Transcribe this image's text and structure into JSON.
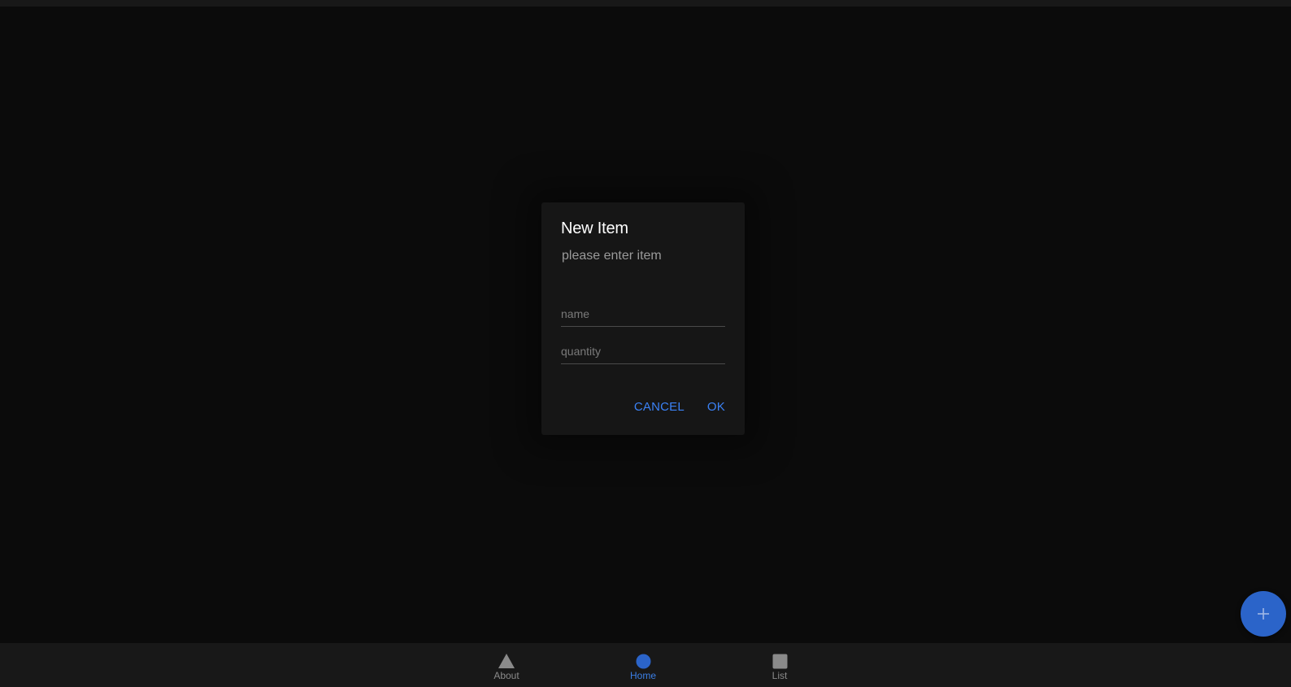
{
  "dialog": {
    "title": "New Item",
    "message": "please enter item",
    "name_placeholder": "name",
    "name_value": "",
    "quantity_placeholder": "quantity",
    "quantity_value": "",
    "cancel_label": "CANCEL",
    "ok_label": "OK"
  },
  "fab": {
    "icon": "plus-icon"
  },
  "bottom_nav": {
    "items": [
      {
        "label": "About",
        "icon": "triangle-icon",
        "active": false
      },
      {
        "label": "Home",
        "icon": "circle-icon",
        "active": true
      },
      {
        "label": "List",
        "icon": "square-icon",
        "active": false
      }
    ]
  },
  "colors": {
    "accent": "#3b82f6",
    "fab": "#2b64c9",
    "background": "#0b0b0b",
    "surface": "#161616"
  }
}
